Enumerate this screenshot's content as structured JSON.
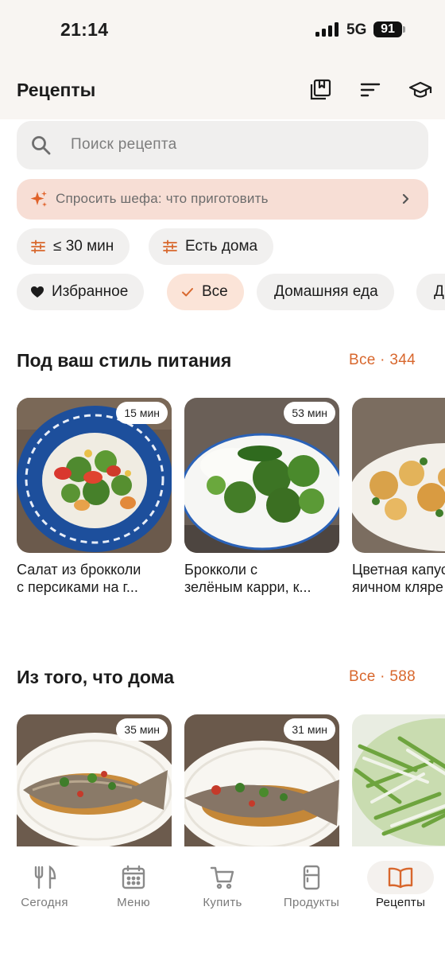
{
  "status": {
    "time": "21:14",
    "network": "5G",
    "battery": "91"
  },
  "header": {
    "title": "Рецепты",
    "icons": [
      "bookmarks-icon",
      "sort-icon",
      "graduation-cap-icon"
    ]
  },
  "search": {
    "placeholder": "Поиск рецепта",
    "icon": "search-icon"
  },
  "chef": {
    "label": "Спросить шефа: что приготовить",
    "icon": "sparkle-icon",
    "accent": "#e0622a"
  },
  "filters": [
    {
      "label": "≤ 30 мин",
      "icon": "sliders-icon"
    },
    {
      "label": "Есть дома",
      "icon": "sliders-icon"
    }
  ],
  "categories": [
    {
      "label": "Избранное",
      "icon": "heart-icon",
      "active": false
    },
    {
      "label": "Все",
      "icon": "check-icon",
      "active": true
    },
    {
      "label": "Домашняя еда",
      "active": false
    },
    {
      "label": "Д",
      "active": false
    }
  ],
  "sections": [
    {
      "title": "Под ваш стиль питания",
      "link": "Все · 344",
      "cards": [
        {
          "time": "15 мин",
          "title_line1": "Салат из брокколи",
          "title_line2": "с персиками на г..."
        },
        {
          "time": "53 мин",
          "title_line1": "Брокколи с",
          "title_line2": "зелёным карри, к..."
        },
        {
          "time": "",
          "title_line1": "Цветная капуста в",
          "title_line2": "яичном кляре"
        }
      ]
    },
    {
      "title": "Из того, что дома",
      "link": "Все · 588",
      "cards": [
        {
          "time": "35 мин"
        },
        {
          "time": "31 мин"
        },
        {
          "time": ""
        }
      ]
    }
  ],
  "tabs": [
    {
      "label": "Сегодня",
      "icon": "fork-knife-icon",
      "active": false
    },
    {
      "label": "Меню",
      "icon": "calendar-icon",
      "active": false
    },
    {
      "label": "Купить",
      "icon": "cart-icon",
      "active": false
    },
    {
      "label": "Продукты",
      "icon": "fridge-icon",
      "active": false
    },
    {
      "label": "Рецепты",
      "icon": "open-book-icon",
      "active": true
    }
  ],
  "colors": {
    "accent": "#d8672d",
    "chip": "#f1f0ef",
    "chip_active": "#fbe4d8",
    "chef_bg": "#f7ded5"
  }
}
